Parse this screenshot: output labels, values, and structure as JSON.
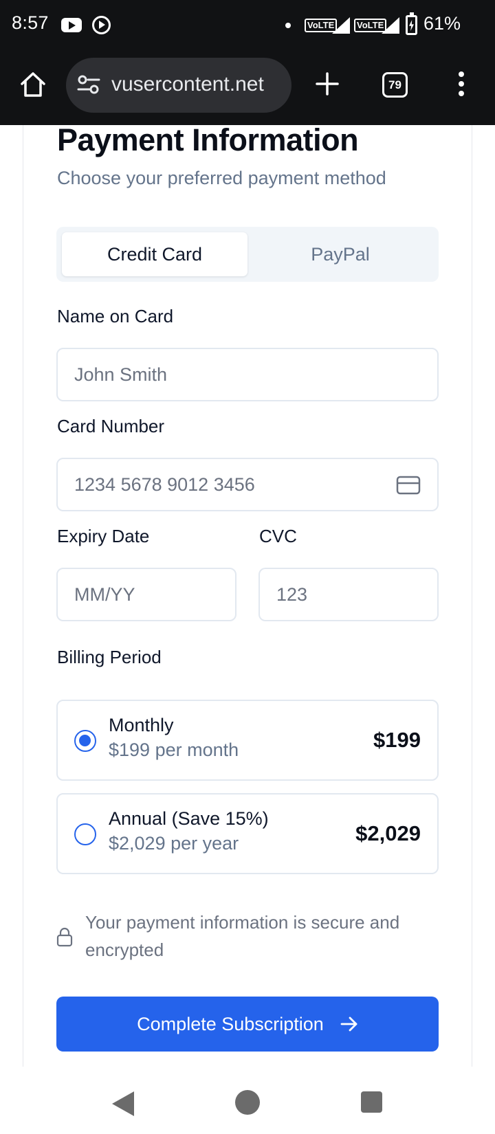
{
  "status_bar": {
    "time": "8:57",
    "icons": [
      "youtube-icon",
      "play-circle-icon",
      "dot-icon",
      "volte-icon",
      "signal-icon",
      "volte-icon",
      "signal-icon",
      "battery-charging-icon"
    ],
    "volte_label": "VoLTE",
    "battery_percent": "61%"
  },
  "browser": {
    "url": "vusercontent.net",
    "tab_count": "79",
    "icons": [
      "home-icon",
      "site-settings-icon",
      "plus-icon",
      "tab-switcher-icon",
      "more-vert-icon"
    ]
  },
  "page": {
    "title": "Payment Information",
    "subtitle": "Choose your preferred payment method",
    "payment_tabs": [
      {
        "label": "Credit Card",
        "active": true
      },
      {
        "label": "PayPal",
        "active": false
      }
    ],
    "fields": {
      "name": {
        "label": "Name on Card",
        "placeholder": "John Smith",
        "value": ""
      },
      "card_number": {
        "label": "Card Number",
        "placeholder": "1234 5678 9012 3456",
        "value": "",
        "icon": "credit-card-icon"
      },
      "expiry": {
        "label": "Expiry Date",
        "placeholder": "MM/YY",
        "value": ""
      },
      "cvc": {
        "label": "CVC",
        "placeholder": "123",
        "value": ""
      }
    },
    "billing": {
      "label": "Billing Period",
      "options": [
        {
          "name": "Monthly",
          "sub": "$199 per month",
          "price": "$199",
          "selected": true
        },
        {
          "name": "Annual (Save 15%)",
          "sub": "$2,029 per year",
          "price": "$2,029",
          "selected": false
        }
      ]
    },
    "secure_note": "Your payment information is secure and encrypted",
    "submit_label": "Complete Subscription",
    "colors": {
      "accent": "#2563eb",
      "muted": "#64748b",
      "border": "#e2e8f0"
    }
  },
  "nav_bar": {
    "icons": [
      "back-icon",
      "home-circle-icon",
      "recents-icon"
    ]
  }
}
